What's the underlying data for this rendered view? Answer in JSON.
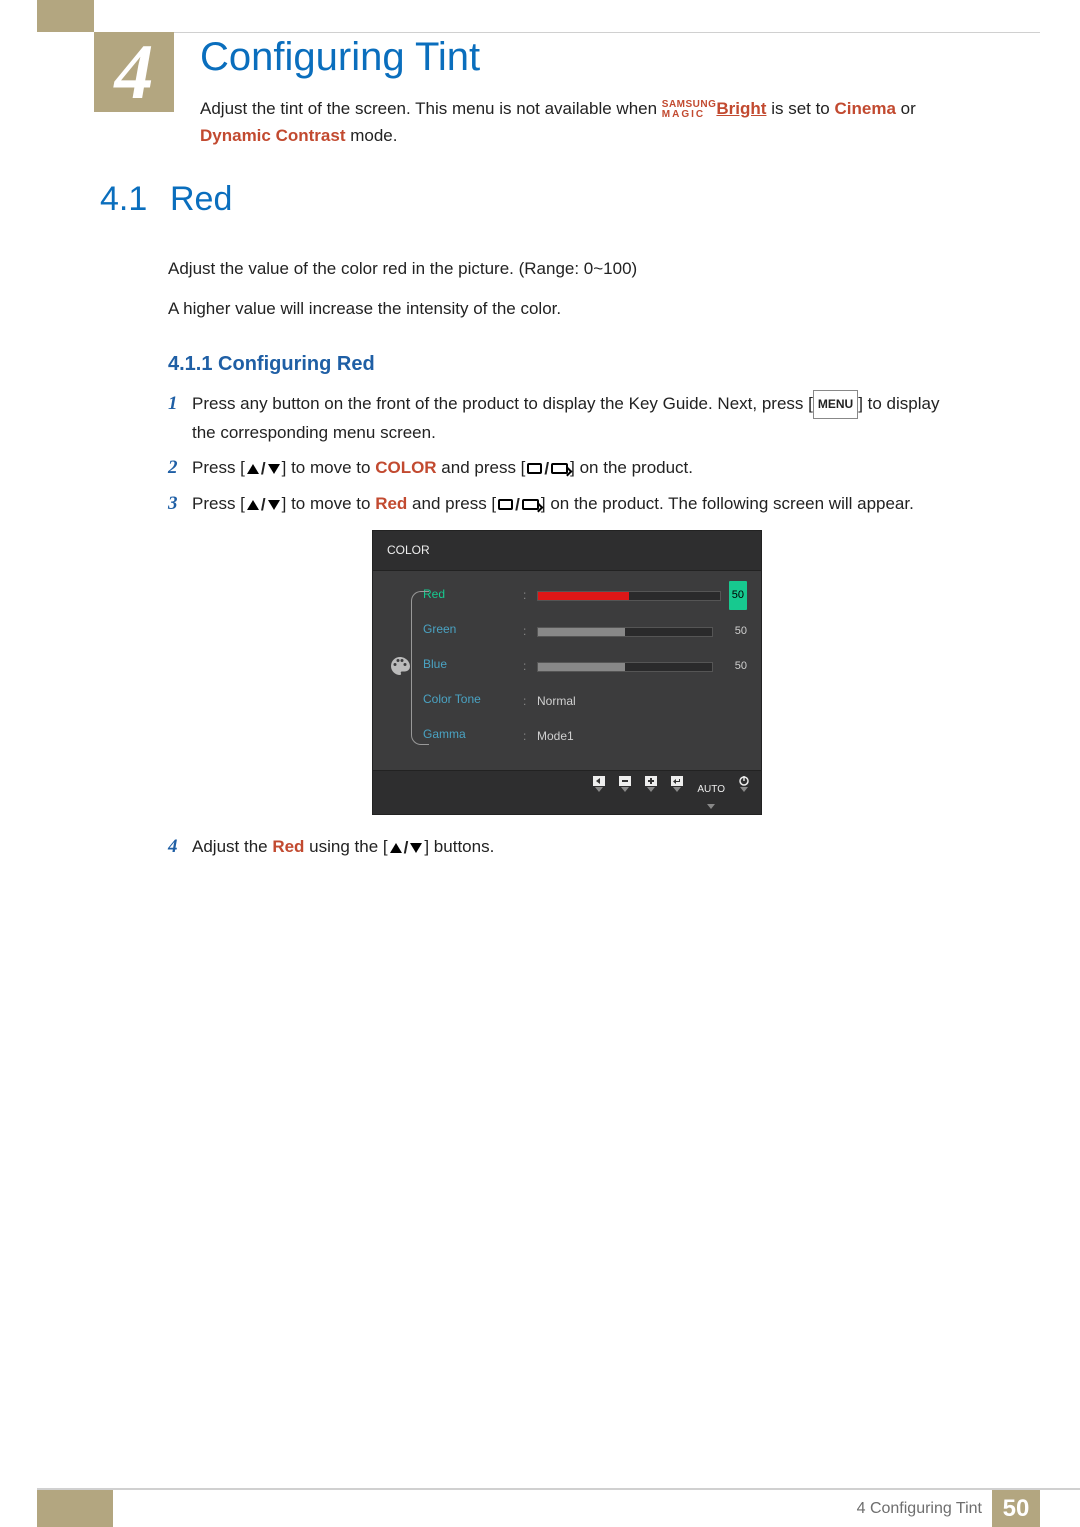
{
  "chapter": {
    "number": "4",
    "title": "Configuring Tint",
    "intro_a": "Adjust the tint of the screen. This menu is not available when ",
    "magic_top": "SAMSUNG",
    "magic_bot": "MAGIC",
    "magic_bright": "Bright",
    "intro_b": " is set to ",
    "cinema": "Cinema",
    "intro_c": " or ",
    "dyn": "Dynamic Contrast",
    "intro_d": " mode."
  },
  "section": {
    "num": "4.1",
    "title": "Red",
    "p1": "Adjust the value of the color red in the picture. (Range: 0~100)",
    "p2": "A higher value will increase the intensity of the color."
  },
  "subsection": {
    "label": "4.1.1   Configuring Red"
  },
  "steps": {
    "s1a": "Press any button on the front of the product to display the Key Guide. Next, press [",
    "menu": "MENU",
    "s1b": "] to display the corresponding menu screen.",
    "s2a": "Press [",
    "s2b": "] to move to ",
    "color_kw": "COLOR",
    "s2c": " and press [",
    "s2d": "] on the product.",
    "s3a": "Press [",
    "s3b": "] to move to ",
    "red_kw": "Red",
    "s3c": " and press [",
    "s3d": "] on the product. The following screen will appear.",
    "s4a": "Adjust the ",
    "s4b": " using the [",
    "s4c": "] buttons."
  },
  "osd": {
    "title": "COLOR",
    "rows": {
      "red": {
        "label": "Red",
        "value": "50",
        "fill": 50
      },
      "green": {
        "label": "Green",
        "value": "50",
        "fill": 50
      },
      "blue": {
        "label": "Blue",
        "value": "50",
        "fill": 50
      },
      "tone": {
        "label": "Color Tone",
        "value": "Normal"
      },
      "gamma": {
        "label": "Gamma",
        "value": "Mode1"
      }
    },
    "strip": {
      "auto": "AUTO"
    }
  },
  "footer": {
    "text": "4 Configuring Tint",
    "page": "50"
  }
}
